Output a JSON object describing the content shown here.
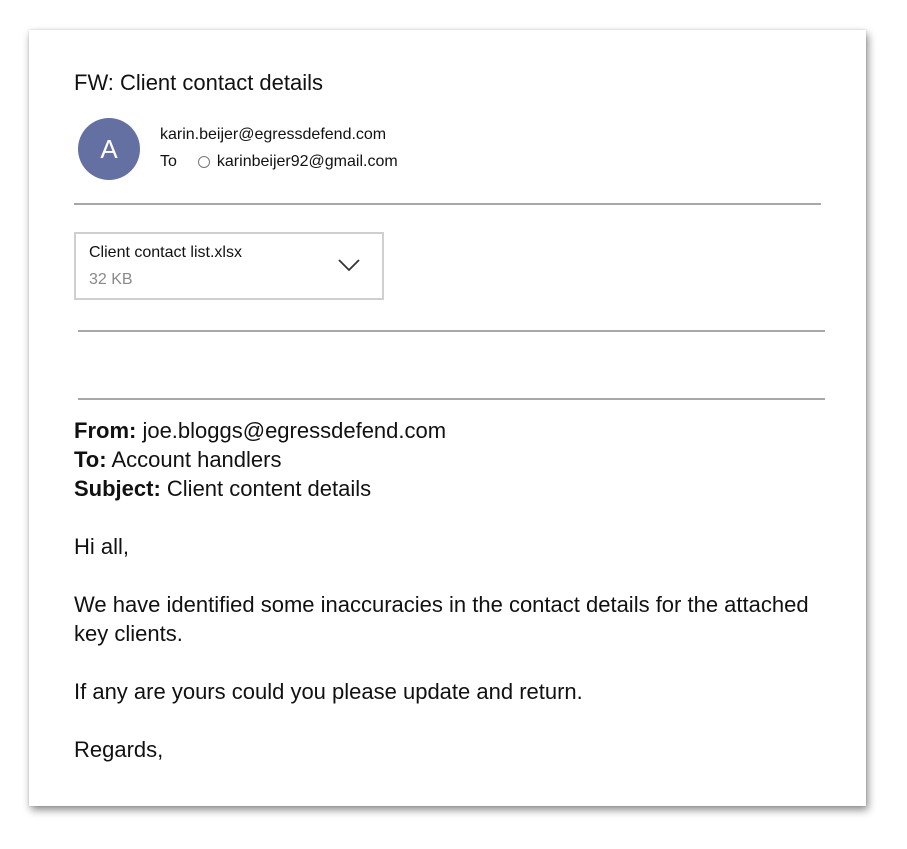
{
  "email": {
    "subject": "FW: Client contact details",
    "avatar_initial": "A",
    "sender_email": "karin.beijer@egressdefend.com",
    "to_label": "To",
    "recipient_email": "karinbeijer92@gmail.com"
  },
  "attachment": {
    "name": "Client contact list.xlsx",
    "size": "32 KB",
    "icon": "chevron-down-icon"
  },
  "forwarded": {
    "from_label": "From:",
    "from_value": " joe.bloggs@egressdefend.com",
    "to_label": "To:",
    "to_value": " Account handlers",
    "subject_label": "Subject:",
    "subject_value": " Client content details"
  },
  "message": {
    "greeting": "Hi all,",
    "paragraph1": "We have identified some inaccuracies in the contact details for the attached key clients.",
    "paragraph2": "If any are yours could you please update and return.",
    "signoff": "Regards,"
  },
  "colors": {
    "avatar_bg": "#6470a1",
    "divider": "#a8a8a8",
    "muted_text": "#8a8a8a"
  }
}
